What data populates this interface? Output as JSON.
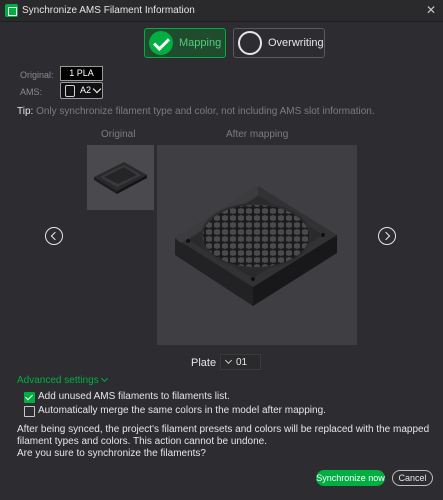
{
  "window": {
    "title": "Synchronize AMS Filament Information"
  },
  "modes": {
    "mapping": "Mapping",
    "overwriting": "Overwriting"
  },
  "mapping_row": {
    "original_label": "Original:",
    "original_value": "1 PLA",
    "ams_label": "AMS:",
    "ams_value": "A2"
  },
  "tip": {
    "key": "Tip:",
    "text": "Only synchronize filament type and color, not including AMS slot information."
  },
  "preview": {
    "original_header": "Original",
    "after_header": "After mapping"
  },
  "plate": {
    "label": "Plate",
    "value": "01"
  },
  "advanced": {
    "label": "Advanced settings"
  },
  "options": [
    {
      "label": "Add unused AMS filaments to filaments list.",
      "checked": true
    },
    {
      "label": "Automatically merge the same colors in the model after mapping.",
      "checked": false
    }
  ],
  "warning": [
    "After being synced, the project's filament presets and colors will be replaced with the mapped",
    "filament types and colors. This action cannot be undone.",
    "Are you sure to synchronize the filaments?"
  ],
  "buttons": {
    "sync": "Synchronize now",
    "cancel": "Cancel"
  },
  "colors": {
    "accent": "#00ae42",
    "background": "#2d2d31"
  }
}
